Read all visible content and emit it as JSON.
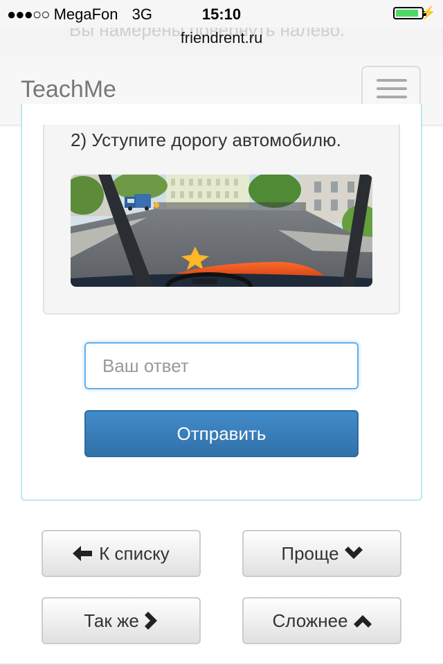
{
  "status_bar": {
    "signal": "●●●○○",
    "carrier": "MegaFon",
    "network": "3G",
    "time": "15:10",
    "battery_level": 0.9,
    "battery_color": "#4cd964"
  },
  "browser": {
    "url": "friendrent.ru",
    "scrolled_text": "Вы намерены повернуть налево."
  },
  "navbar": {
    "brand": "TeachMe",
    "menu_icon": "hamburger-icon"
  },
  "question": {
    "option_text": "2) Уступите дорогу автомобилю."
  },
  "answer_form": {
    "placeholder": "Ваш ответ",
    "value": "",
    "submit_label": "Отправить"
  },
  "navigation": {
    "back_label": "К списку",
    "back_icon": "arrow-left-icon",
    "easier_label": "Проще",
    "easier_icon": "chevron-down-icon",
    "same_label": "Так же",
    "same_icon": "chevron-right-icon",
    "harder_label": "Сложнее",
    "harder_icon": "chevron-up-icon"
  },
  "colors": {
    "primary": "#428bca",
    "panel_border": "#bce8f1",
    "focus": "#66afe9"
  }
}
